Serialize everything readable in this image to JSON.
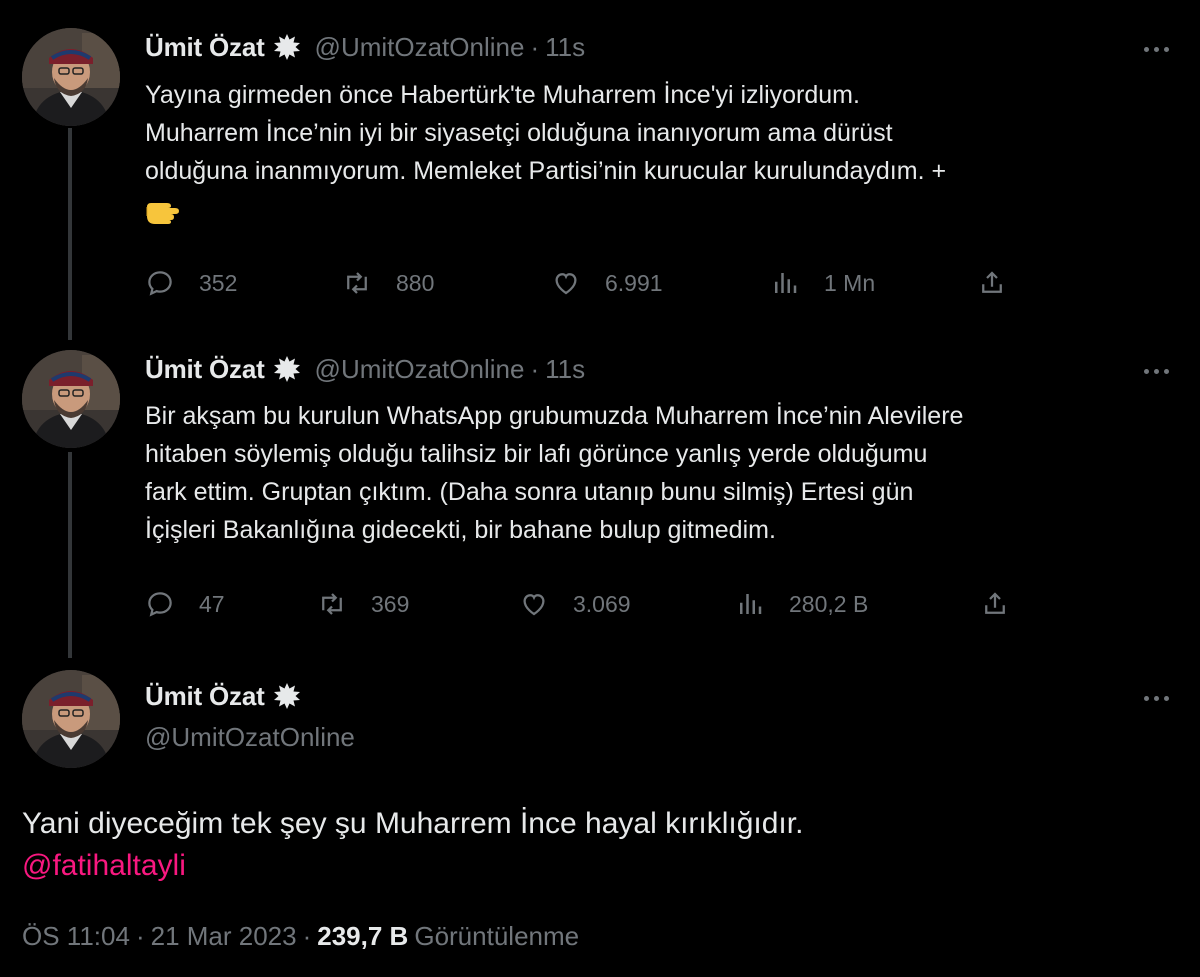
{
  "author": {
    "name": "Ümit Özat",
    "handle": "@UmitOzatOnline",
    "badge_color": "#e7e9ea"
  },
  "tweets": [
    {
      "time": "11s",
      "lines": [
        "Yayına girmeden önce Habertürk'te Muharrem İnce'yi izliyordum.",
        "Muharrem İnce’nin iyi bir siyasetçi olduğuna inanıyorum ama dürüst",
        "olduğuna inanmıyorum. Memleket Partisi’nin kurucular kurulundaydım. +"
      ],
      "emoji": "backhand-index-pointing-left",
      "replies": "352",
      "retweets": "880",
      "likes": "6.991",
      "views": "1 Mn"
    },
    {
      "time": "11s",
      "lines": [
        "Bir akşam bu kurulun WhatsApp grubumuzda Muharrem İnce’nin Alevilere",
        "hitaben söylemiş olduğu talihsiz bir lafı görünce yanlış yerde olduğumu",
        "fark ettim. Gruptan çıktım. (Daha sonra utanıp bunu silmiş) Ertesi gün",
        "İçişleri Bakanlığına gidecekti, bir bahane bulup gitmedim."
      ],
      "replies": "47",
      "retweets": "369",
      "likes": "3.069",
      "views": "280,2 B"
    }
  ],
  "main_tweet": {
    "text": "Yani diyeceğim tek şey şu Muharrem İnce hayal kırıklığıdır.",
    "mention": "@fatihaltayli",
    "time": "ÖS 11:04",
    "date": "21 Mar 2023",
    "views_count": "239,7 B",
    "views_label": "Görüntülenme"
  },
  "colors": {
    "background": "#000000",
    "text": "#e7e9ea",
    "muted": "#71767b",
    "mention": "#f91880",
    "thread_line": "#333639"
  },
  "icons": [
    "verified-badge-icon",
    "more-icon",
    "reply-icon",
    "retweet-icon",
    "like-icon",
    "views-icon",
    "share-icon"
  ]
}
